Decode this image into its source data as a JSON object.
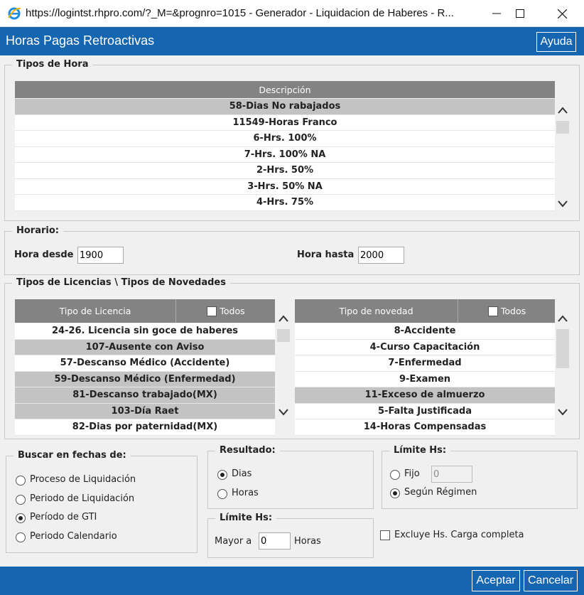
{
  "window": {
    "title": "https://logintst.rhpro.com/?_M=&prognro=1015 - Generador - Liquidacion de Haberes - R..."
  },
  "header": {
    "title": "Horas Pagas Retroactivas",
    "help_label": "Ayuda"
  },
  "tipos_hora": {
    "legend": "Tipos de Hora",
    "column": "Descripción",
    "rows": [
      "58-Dias No rabajados",
      "11549-Horas Franco",
      "6-Hrs. 100%",
      "7-Hrs. 100% NA",
      "2-Hrs. 50%",
      "3-Hrs. 50% NA",
      "4-Hrs. 75%"
    ]
  },
  "horario": {
    "legend": "Horario:",
    "desde_label": "Hora desde",
    "desde_value": "1900",
    "hasta_label": "Hora hasta",
    "hasta_value": "2000"
  },
  "licencias": {
    "legend": "Tipos de Licencias \\ Tipos de Novedades",
    "lic_column": "Tipo de Licencia",
    "nov_column": "Tipo de novedad",
    "todos_label": "Todos",
    "lic_rows": [
      "24-26. Licencia sin goce de haberes",
      "107-Ausente con Aviso",
      "57-Descanso Médico (Accidente)",
      "59-Descanso Médico (Enfermedad)",
      "81-Descanso trabajado(MX)",
      "103-Día Raet",
      "82-Dias por paternidad(MX)"
    ],
    "nov_rows": [
      "8-Accidente",
      "4-Curso Capacitación",
      "7-Enfermedad",
      "9-Examen",
      "11-Exceso de almuerzo",
      "5-Falta Justificada",
      "14-Horas Compensadas"
    ]
  },
  "buscar": {
    "legend": "Buscar en fechas de:",
    "options": [
      "Proceso de Liquidación",
      "Periodo de Liquidación",
      "Período de GTI",
      "Periodo Calendario"
    ],
    "selected": "Período de GTI"
  },
  "resultado": {
    "legend": "Resultado:",
    "options": [
      "Dias",
      "Horas"
    ],
    "selected": "Dias"
  },
  "limite_hs_top": {
    "legend": "Límite Hs:",
    "fijo_label": "Fijo",
    "fijo_value": "0",
    "segun_label": "Según Régimen",
    "selected": "Según Régimen"
  },
  "limite_hs_bottom": {
    "legend": "Límite Hs:",
    "mayor_label": "Mayor a",
    "mayor_value": "0",
    "horas_label": "Horas"
  },
  "excluye_label": "Excluye Hs. Carga completa",
  "footer": {
    "accept_label": "Aceptar",
    "cancel_label": "Cancelar"
  },
  "colors": {
    "accent": "#1565b0",
    "grid_header": "#838383",
    "row_selected": "#c3c3c3"
  }
}
